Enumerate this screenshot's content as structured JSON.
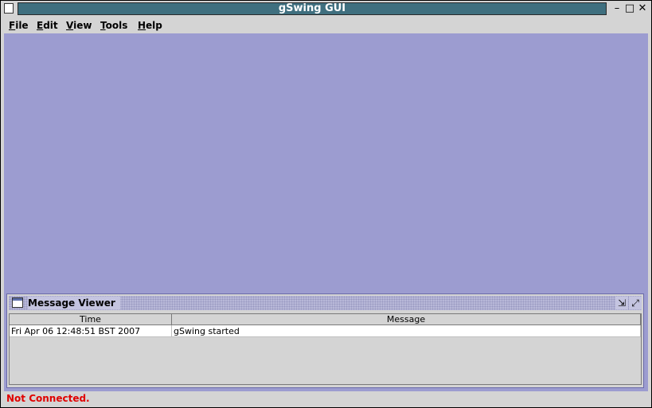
{
  "window": {
    "title": "gSwing GUI",
    "minimize_glyph": "–",
    "maximize_glyph": "□",
    "close_glyph": "✕"
  },
  "menubar": {
    "items": [
      {
        "mnemonic": "F",
        "rest": "ile"
      },
      {
        "mnemonic": "E",
        "rest": "dit"
      },
      {
        "mnemonic": "V",
        "rest": "iew"
      },
      {
        "mnemonic": "T",
        "rest": "ools"
      },
      {
        "mnemonic": "H",
        "rest": "elp"
      }
    ]
  },
  "message_viewer": {
    "title": "Message Viewer",
    "iconify_glyph": "⇲",
    "maximize_glyph": "⤢",
    "columns": [
      "Time",
      "Message"
    ],
    "rows": [
      {
        "time": "Fri Apr 06 12:48:51 BST 2007",
        "message": "gSwing started"
      }
    ]
  },
  "status": {
    "text": "Not Connected."
  },
  "colors": {
    "desktop": "#9c9cd0",
    "titlebar": "#3f6f7f",
    "status_error": "#e00000"
  }
}
